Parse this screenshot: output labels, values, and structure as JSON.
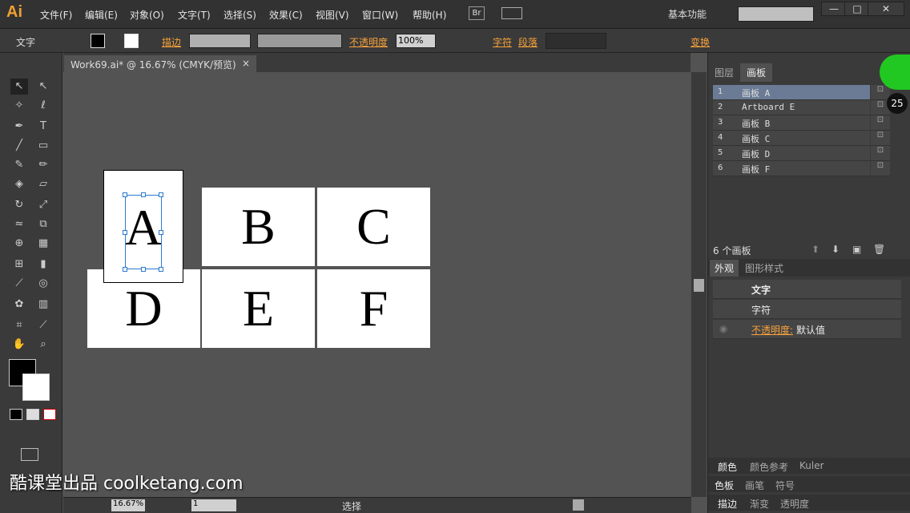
{
  "app_logo": "Ai",
  "menu": [
    "文件(F)",
    "编辑(E)",
    "对象(O)",
    "文字(T)",
    "选择(S)",
    "效果(C)",
    "视图(V)",
    "窗口(W)",
    "帮助(H)"
  ],
  "bridge": "Br",
  "workspace": "基本功能",
  "window_controls": [
    "—",
    "□",
    "✕"
  ],
  "control": {
    "type_label": "文字",
    "stroke": "描边",
    "opacity_label": "不透明度",
    "opacity_value": "100%",
    "char": "字符",
    "para": "段落",
    "transform": "变换"
  },
  "doc_tab": {
    "title": "Work69.ai* @ 16.67% (CMYK/预览)",
    "close": "×"
  },
  "artboards_canvas": [
    "A",
    "B",
    "C",
    "D",
    "E",
    "F"
  ],
  "panel_artboards": {
    "tabs": [
      "图层",
      "画板"
    ],
    "rows": [
      {
        "num": "1",
        "name": "画板 A"
      },
      {
        "num": "2",
        "name": "Artboard E"
      },
      {
        "num": "3",
        "name": "画板 B"
      },
      {
        "num": "4",
        "name": "画板 C"
      },
      {
        "num": "5",
        "name": "画板 D"
      },
      {
        "num": "6",
        "name": "画板 F"
      }
    ],
    "count": "6 个画板",
    "badge": "25"
  },
  "panel_appearance": {
    "tabs": [
      "外观",
      "图形样式"
    ],
    "title": "文字",
    "char": "字符",
    "opacity_label": "不透明度:",
    "opacity_value": "默认值"
  },
  "dock_rows": [
    [
      "颜色",
      "颜色参考",
      "Kuler"
    ],
    [
      "色板",
      "画笔",
      "符号"
    ],
    [
      "描边",
      "渐变",
      "透明度"
    ]
  ],
  "status": {
    "zoom": "16.67%",
    "page": "1",
    "mode": "选择"
  },
  "watermark": "酷课堂出品 coolketang.com"
}
